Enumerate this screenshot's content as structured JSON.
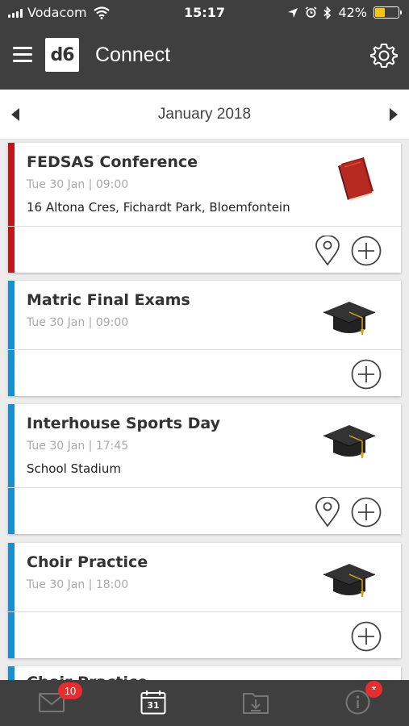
{
  "status_bar": {
    "carrier": "Vodacom",
    "time": "15:17",
    "battery_percent": "42%",
    "battery_level": 0.42
  },
  "app_bar": {
    "logo": "d6",
    "title": "Connect"
  },
  "calendar": {
    "month": "January 2018"
  },
  "events": [
    {
      "title": "FEDSAS Conference",
      "datetime": "Tue 30 Jan | 09:00",
      "location": "16 Altona Cres, Fichardt Park, Bloemfontein",
      "icon": "book-icon",
      "stripe_color": "#c0151b"
    },
    {
      "title": "Matric Final Exams",
      "datetime": "Tue 30 Jan | 09:00",
      "location": "",
      "icon": "graduation-cap-icon",
      "stripe_color": "#1a8fd0"
    },
    {
      "title": "Interhouse Sports Day",
      "datetime": "Tue 30 Jan | 17:45",
      "location": "School Stadium",
      "icon": "graduation-cap-icon",
      "stripe_color": "#1a8fd0"
    },
    {
      "title": "Choir Practice",
      "datetime": "Tue 30 Jan | 18:00",
      "location": "",
      "icon": "graduation-cap-icon",
      "stripe_color": "#1a8fd0"
    },
    {
      "title": "Choir Practice",
      "datetime": "",
      "location": "",
      "icon": "",
      "stripe_color": "#1a8fd0"
    }
  ],
  "tab_bar": {
    "messages_badge": "10",
    "calendar_day": "31",
    "info_badge": "*"
  }
}
